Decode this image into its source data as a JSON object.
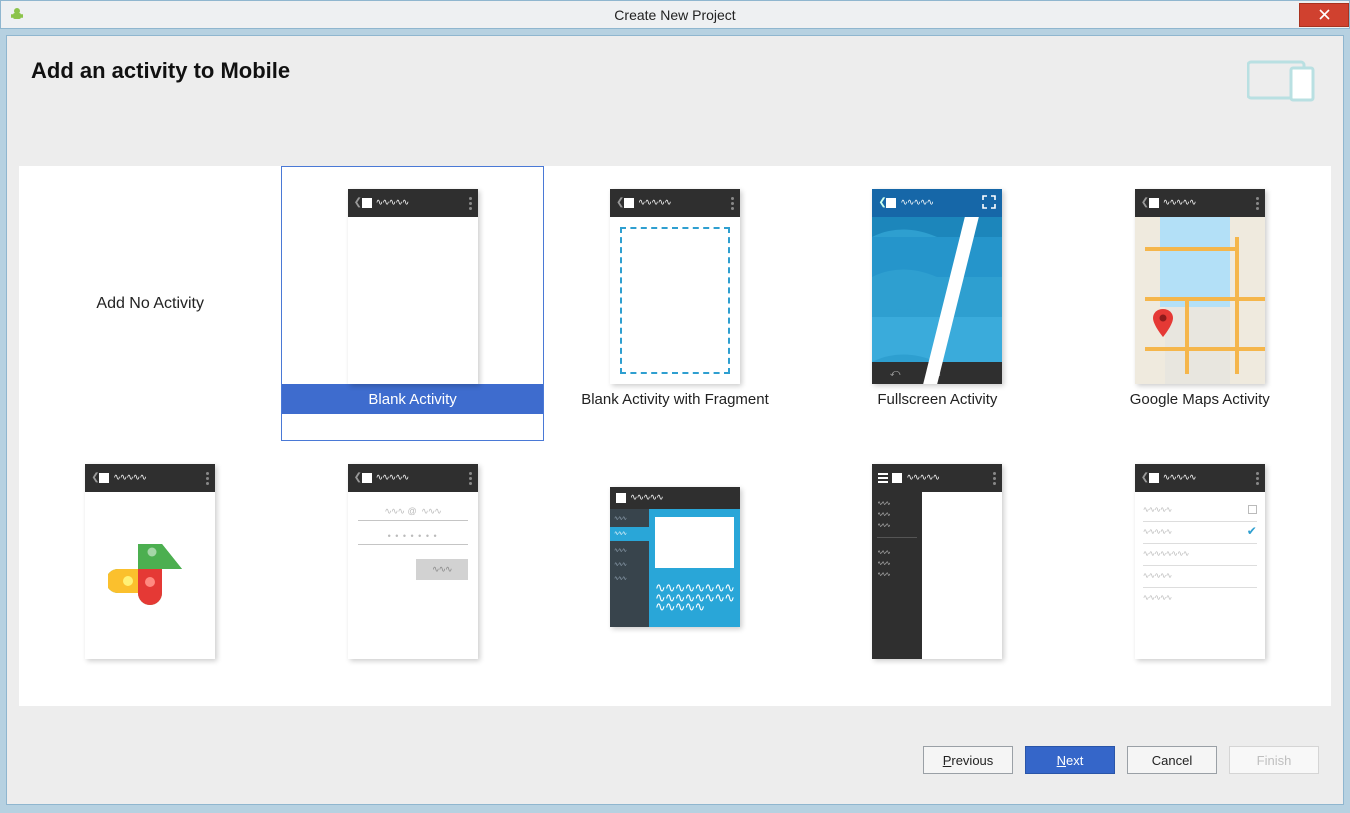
{
  "window": {
    "title": "Create New Project"
  },
  "header": {
    "heading": "Add an activity to Mobile"
  },
  "activities": [
    {
      "id": "no-activity",
      "label": "Add No Activity",
      "selected": false
    },
    {
      "id": "blank",
      "label": "Blank Activity",
      "selected": true
    },
    {
      "id": "blank-fragment",
      "label": "Blank Activity with Fragment",
      "selected": false
    },
    {
      "id": "fullscreen",
      "label": "Fullscreen Activity",
      "selected": false
    },
    {
      "id": "maps",
      "label": "Google Maps Activity",
      "selected": false
    },
    {
      "id": "google-play-services",
      "label": "",
      "selected": false
    },
    {
      "id": "login",
      "label": "",
      "selected": false
    },
    {
      "id": "master-detail",
      "label": "",
      "selected": false
    },
    {
      "id": "nav-drawer",
      "label": "",
      "selected": false
    },
    {
      "id": "settings",
      "label": "",
      "selected": false
    }
  ],
  "footer": {
    "previous": "Previous",
    "next": "Next",
    "cancel": "Cancel",
    "finish": "Finish",
    "previous_key": "P",
    "next_key": "N"
  }
}
